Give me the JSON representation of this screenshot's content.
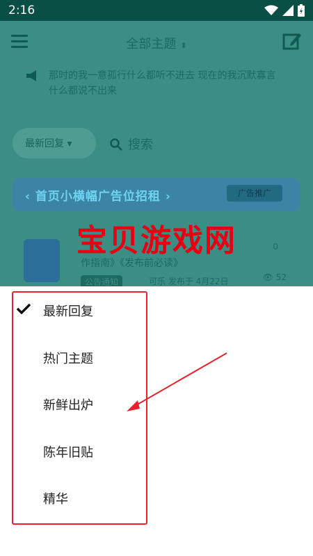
{
  "status_bar": {
    "time": "2:16",
    "icons": [
      "wifi-icon",
      "signal-icon",
      "battery-icon"
    ]
  },
  "app_bar": {
    "title": "全部主题",
    "sort_indicator": "sort-arrows-icon",
    "menu_icon": "hamburger-icon",
    "action_icon": "edit-icon"
  },
  "notice": {
    "text": "那时的我一意孤行什么都听不进去 现在的我沉默寡言什么都说不出来"
  },
  "filter": {
    "label": "最新回复",
    "search_placeholder": "搜索"
  },
  "banner": {
    "text": "‹ 首页小横幅广告位招租 ›",
    "tag": "广告推广"
  },
  "post": {
    "title": "作指南》《发布前必读》",
    "tag": "公告通知",
    "author": "可乐 发布于 4月22日",
    "replies": "0",
    "views": "52"
  },
  "watermark": "宝贝游戏网",
  "sort_menu": {
    "selected": "最新回复",
    "items": [
      {
        "label": "最新回复"
      },
      {
        "label": "热门主题"
      },
      {
        "label": "新鲜出炉"
      },
      {
        "label": "陈年旧贴"
      },
      {
        "label": "精华"
      }
    ]
  },
  "colors": {
    "overlay_bg": "#3a8e83",
    "annotation_red": "#e8212b",
    "watermark_red": "#e60012"
  }
}
